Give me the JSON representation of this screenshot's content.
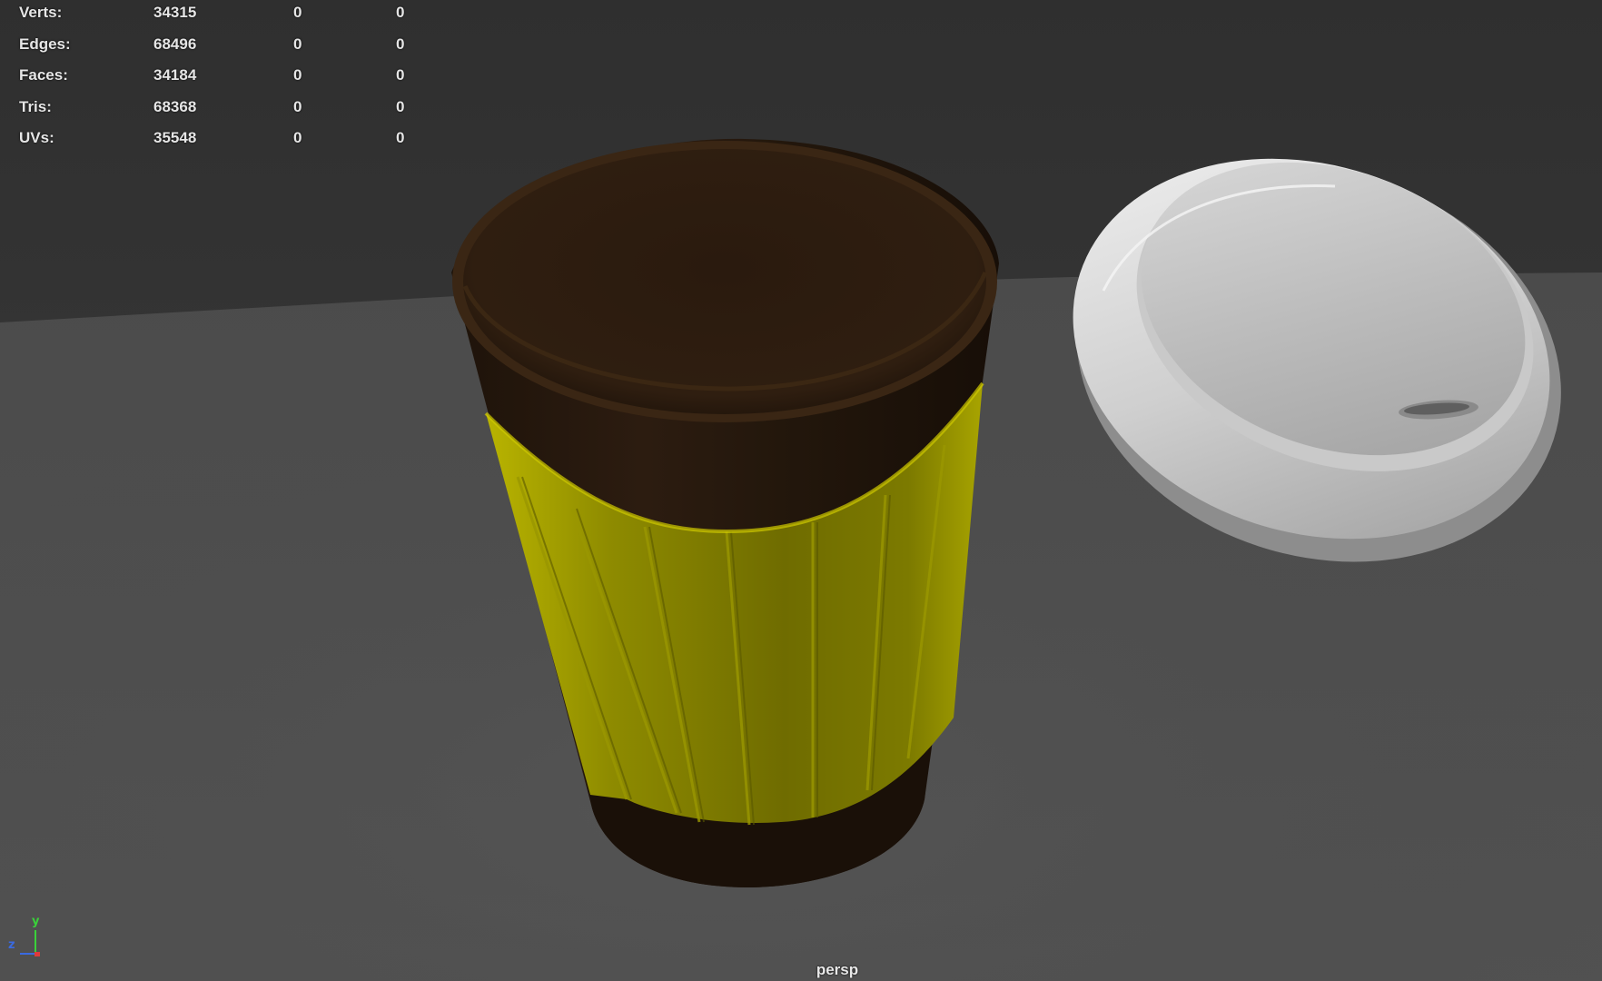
{
  "hud": {
    "rows": [
      {
        "label": "Verts:",
        "c1": "34315",
        "c2": "0",
        "c3": "0"
      },
      {
        "label": "Edges:",
        "c1": "68496",
        "c2": "0",
        "c3": "0"
      },
      {
        "label": "Faces:",
        "c1": "34184",
        "c2": "0",
        "c3": "0"
      },
      {
        "label": "Tris:",
        "c1": "68368",
        "c2": "0",
        "c3": "0"
      },
      {
        "label": "UVs:",
        "c1": "35548",
        "c2": "0",
        "c3": "0"
      }
    ]
  },
  "viewport": {
    "camera": "persp"
  },
  "axis": {
    "x": "x",
    "y": "y",
    "z": "z",
    "colors": {
      "x": "#e03a3a",
      "y": "#3ad13a",
      "z": "#3a6ae0"
    }
  },
  "colors": {
    "background_far": "#383838",
    "floor": "#4d4d4d",
    "cup_brown": "#2b1b10",
    "sleeve_yellow": "#7f7d00",
    "lid_white": "#d9d9d9"
  }
}
